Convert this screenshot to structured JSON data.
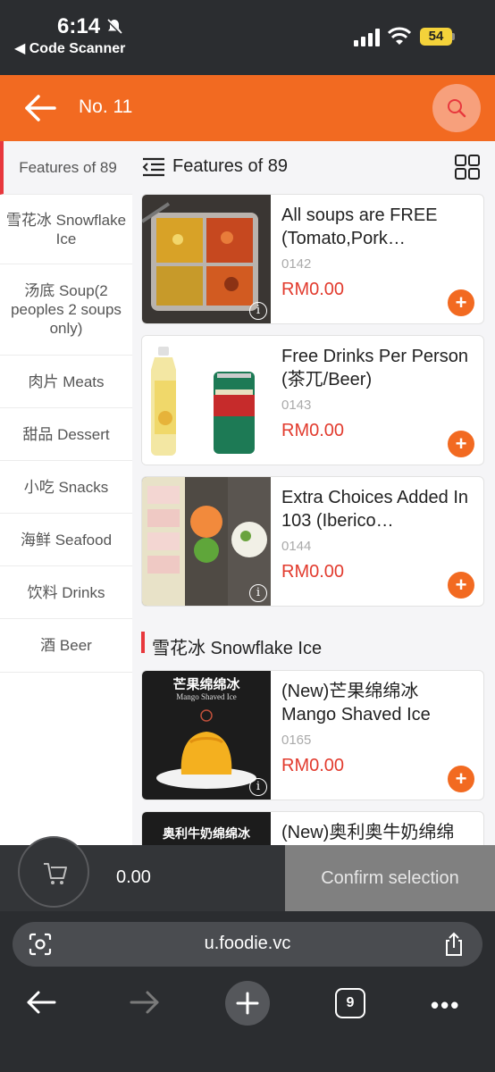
{
  "status_bar": {
    "time": "6:14",
    "back_app": "◀ Code Scanner",
    "battery": "54"
  },
  "header": {
    "title": "No. 11"
  },
  "sidebar": {
    "items": [
      {
        "label": "Features of 89",
        "active": true
      },
      {
        "label": "雪花冰 Snowflake Ice"
      },
      {
        "label": "汤底 Soup(2 peoples 2 soups only)"
      },
      {
        "label": "肉片 Meats"
      },
      {
        "label": "甜品 Dessert"
      },
      {
        "label": "小吃 Snacks"
      },
      {
        "label": "海鲜 Seafood"
      },
      {
        "label": "饮料 Drinks"
      },
      {
        "label": "酒 Beer"
      }
    ]
  },
  "main": {
    "section_title": "Features of 89",
    "items": [
      {
        "name": "All soups are FREE (Tomato,Pork…",
        "code": "0142",
        "price": "RM0.00"
      },
      {
        "name": "Free Drinks Per Person (茶兀/Beer)",
        "code": "0143",
        "price": "RM0.00"
      },
      {
        "name": "Extra Choices Added In 103 (Iberico…",
        "code": "0144",
        "price": "RM0.00"
      }
    ],
    "category_title": "雪花冰 Snowflake Ice",
    "category_items": [
      {
        "name": "(New)芒果绵绵冰 Mango Shaved Ice",
        "code": "0165",
        "price": "RM0.00",
        "image_text_cn": "芒果绵绵冰",
        "image_text_en": "Mango Shaved Ice"
      },
      {
        "name": "(New)奥利奥牛奶绵绵",
        "image_text_cn": "奥利牛奶绵绵冰"
      }
    ],
    "add_symbol": "+",
    "info_symbol": "i"
  },
  "cart": {
    "total": "0.00",
    "confirm_label": "Confirm selection"
  },
  "browser": {
    "url": "u.foodie.vc",
    "tab_count": "9"
  },
  "colors": {
    "brand": "#f26a21",
    "price": "#e23b2e",
    "accent_bar": "#e8383d"
  }
}
